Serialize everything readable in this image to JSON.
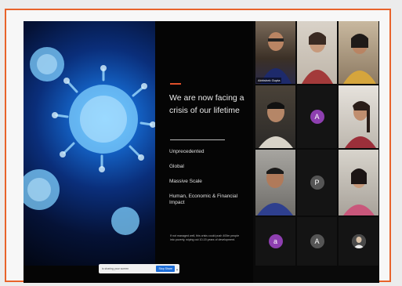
{
  "slide": {
    "title": "We are now facing a crisis of our lifetime",
    "bullets": [
      "Unprecedented",
      "Global",
      "Massive Scale",
      "Human, Economic & Financial Impact"
    ],
    "footnote": "If not managed well, this crisis could push 400m people into poverty, wiping out 10-15 years of development."
  },
  "share_bar": {
    "text": "is sharing your screen",
    "stop_label": "Stop Share"
  },
  "participants": [
    {
      "name": "Abhishek Gupta",
      "avatar": ""
    },
    {
      "name": "",
      "avatar": ""
    },
    {
      "name": "",
      "avatar": ""
    },
    {
      "name": "",
      "avatar": ""
    },
    {
      "name": "",
      "avatar": "A"
    },
    {
      "name": "",
      "avatar": ""
    },
    {
      "name": "",
      "avatar": ""
    },
    {
      "name": "",
      "avatar": "P"
    },
    {
      "name": "",
      "avatar": ""
    },
    {
      "name": "",
      "avatar": "a"
    },
    {
      "name": "",
      "avatar": "A"
    },
    {
      "name": "",
      "avatar": ""
    }
  ],
  "colors": {
    "frame_border": "#e8632b",
    "accent": "#e0502a",
    "avatar_purple": "#8e3fb0",
    "avatar_grey": "#555555"
  }
}
